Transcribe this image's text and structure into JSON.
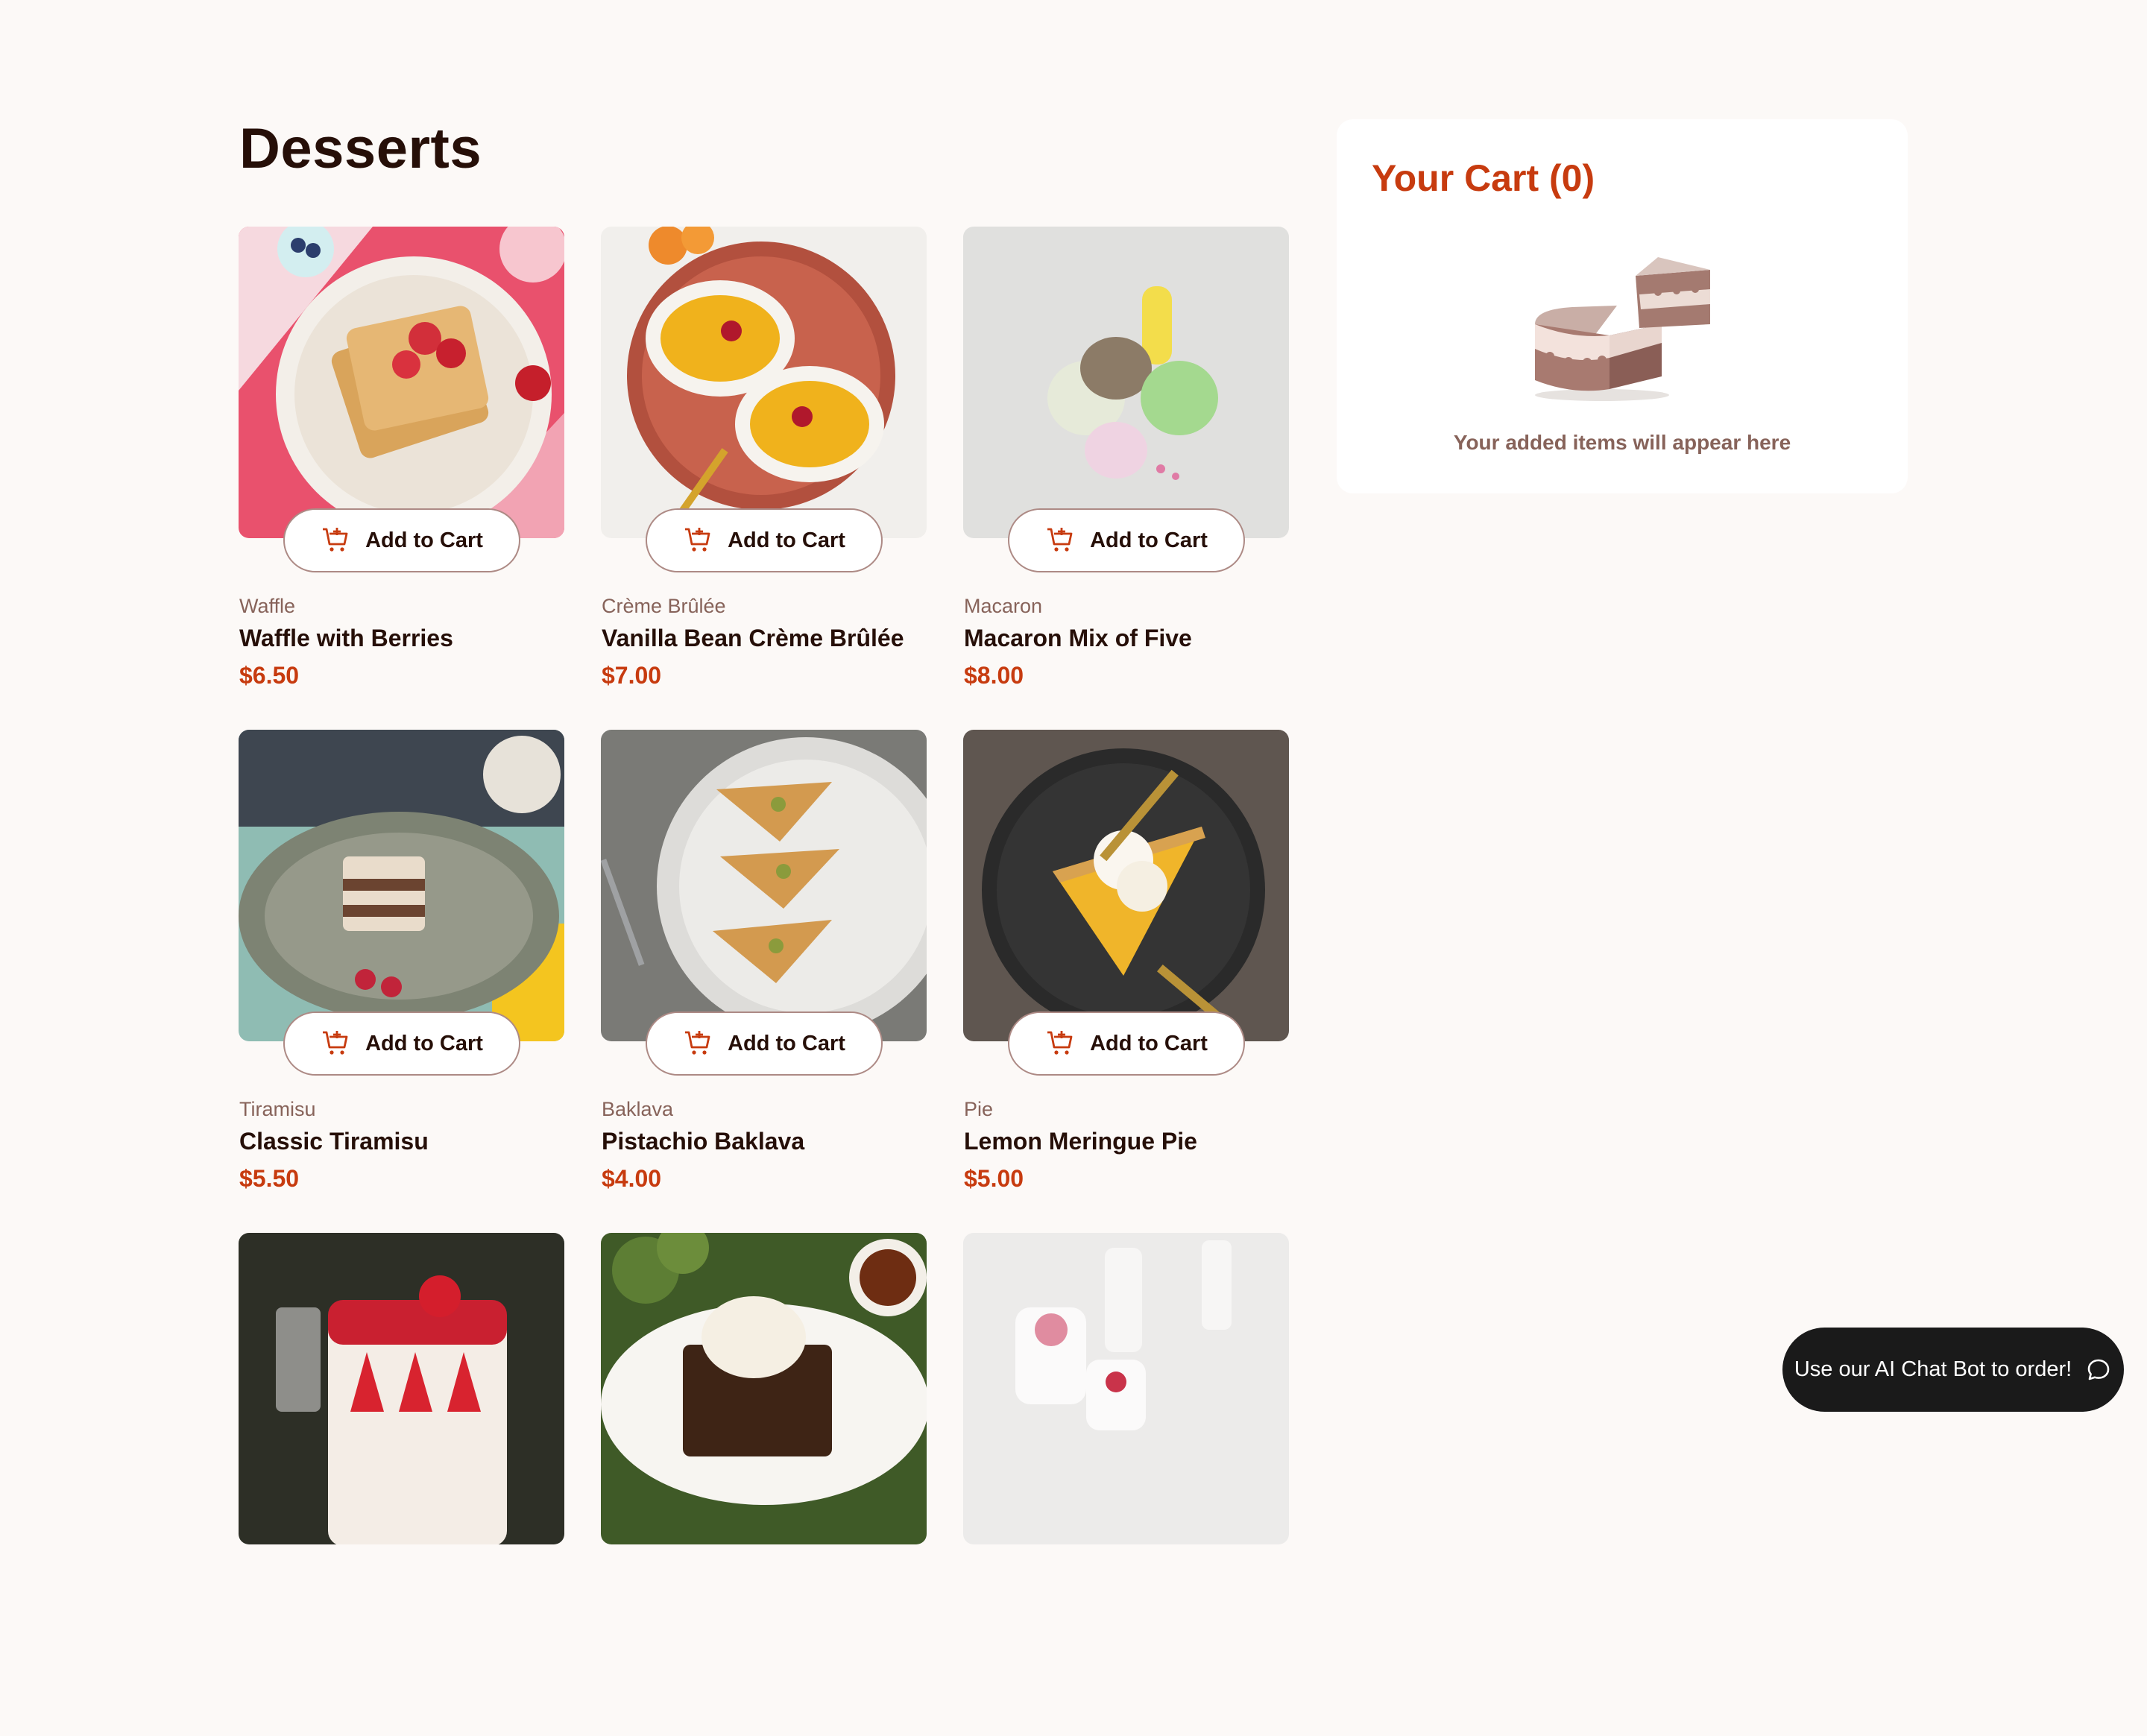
{
  "page": {
    "title": "Desserts"
  },
  "products": [
    {
      "category": "Waffle",
      "name": "Waffle with Berries",
      "price": "$6.50",
      "button": "Add to Cart"
    },
    {
      "category": "Crème Brûlée",
      "name": "Vanilla Bean Crème Brûlée",
      "price": "$7.00",
      "button": "Add to Cart"
    },
    {
      "category": "Macaron",
      "name": "Macaron Mix of Five",
      "price": "$8.00",
      "button": "Add to Cart"
    },
    {
      "category": "Tiramisu",
      "name": "Classic Tiramisu",
      "price": "$5.50",
      "button": "Add to Cart"
    },
    {
      "category": "Baklava",
      "name": "Pistachio Baklava",
      "price": "$4.00",
      "button": "Add to Cart"
    },
    {
      "category": "Pie",
      "name": "Lemon Meringue Pie",
      "price": "$5.00",
      "button": "Add to Cart"
    },
    {
      "category": "",
      "name": "",
      "price": "",
      "button": ""
    },
    {
      "category": "",
      "name": "",
      "price": "",
      "button": ""
    },
    {
      "category": "",
      "name": "",
      "price": "",
      "button": ""
    }
  ],
  "cart": {
    "title": "Your Cart (0)",
    "empty_text": "Your added items will appear here",
    "illustration_icon": "empty-cake-illustration"
  },
  "chat": {
    "label": "Use our AI Chat Bot to order!",
    "icon": "chat-bubble-icon"
  },
  "colors": {
    "accent": "#c73b0f",
    "text": "#260f08",
    "muted": "#87635a",
    "background": "#fcf9f7"
  }
}
